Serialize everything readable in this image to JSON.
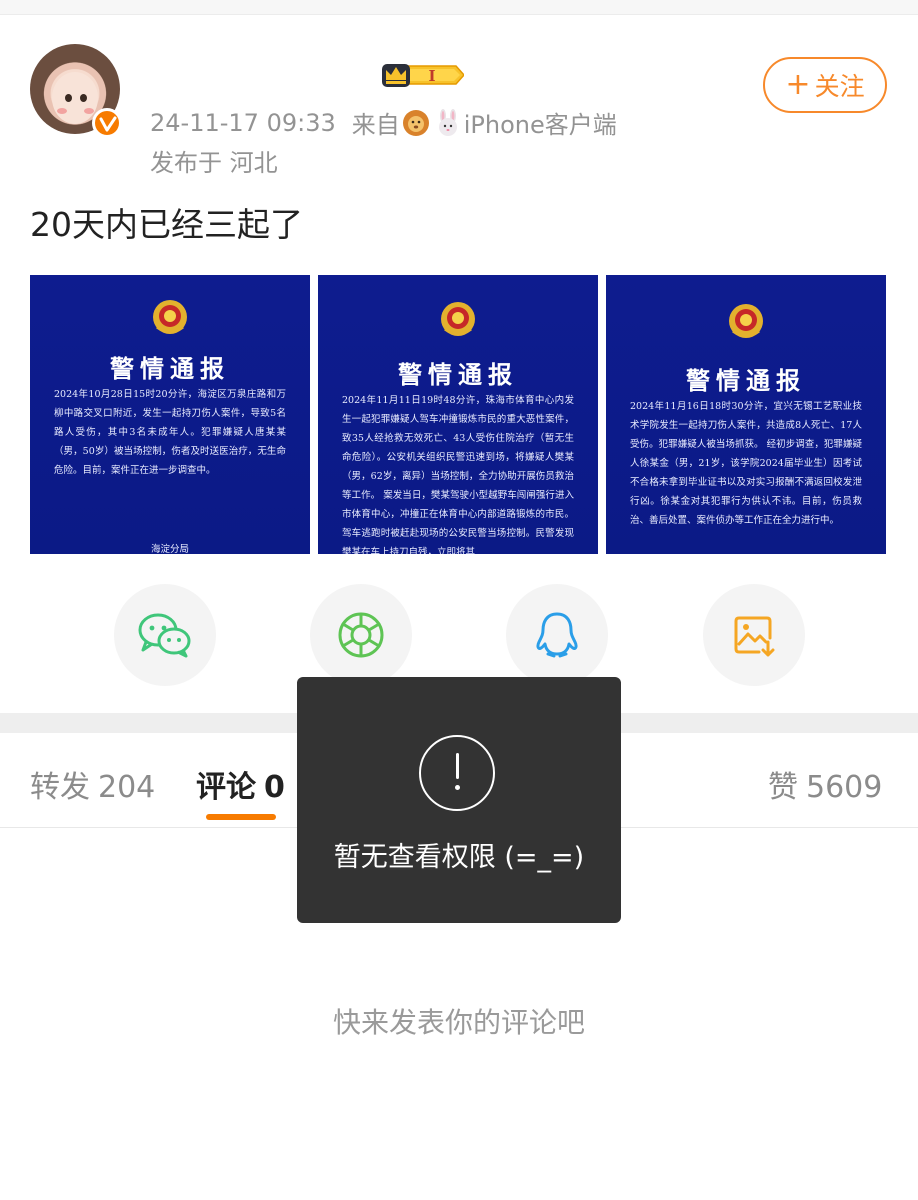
{
  "header": {
    "timestamp": "24-11-17 09:33",
    "source_prefix": "来自",
    "source_device": "iPhone客户端",
    "location": "发布于 河北",
    "follow_label": "关注",
    "badge_level": "I",
    "icons": {
      "avatar": "avatar",
      "verified": "verified-icon",
      "crown": "crown-icon",
      "lion": "lion-emoji-icon",
      "rabbit": "rabbit-emoji-icon"
    }
  },
  "post": {
    "text": "20天内已经三起了"
  },
  "images": [
    {
      "title": "警情通报",
      "body": "2024年10月28日15时20分许，海淀区万泉庄路和万柳中路交叉口附近，发生一起持刀伤人案件，导致5名路人受伤，其中3名未成年人。犯罪嫌疑人唐某某（男，50岁）被当场控制，伤者及时送医治疗，无生命危险。目前，案件正在进一步调查中。",
      "sign": "海淀分局"
    },
    {
      "title": "警情通报",
      "body": "2024年11月11日19时48分许，珠海市体育中心内发生一起犯罪嫌疑人驾车冲撞锻炼市民的重大恶性案件，致35人经抢救无效死亡、43人受伤住院治疗（暂无生命危险）。公安机关组织民警迅速到场，将嫌疑人樊某（男，62岁，离异）当场控制，全力协助开展伤员救治等工作。 案发当日，樊某驾驶小型越野车闯闸强行进入市体育中心，冲撞正在体育中心内部道路锻炼的市民。驾车逃跑时被赶赴现场的公安民警当场控制。民警发现樊某在车上持刀自残，立即将其",
      "sign": ""
    },
    {
      "title": "警情通报",
      "body": "2024年11月16日18时30分许，宜兴无锡工艺职业技术学院发生一起持刀伤人案件，共造成8人死亡、17人受伤。犯罪嫌疑人被当场抓获。 经初步调查，犯罪嫌疑人徐某金（男，21岁，该学院2024届毕业生）因考试不合格未拿到毕业证书以及对实习报酬不满返回校发泄行凶。徐某金对其犯罪行为供认不讳。目前，伤员救治、善后处置、案件侦办等工作正在全力进行中。",
      "sign": ""
    }
  ],
  "share": {
    "icons": [
      "wechat-icon",
      "moments-icon",
      "qq-icon",
      "save-image-icon"
    ]
  },
  "tabs": {
    "repost_label": "转发",
    "repost_count": "204",
    "comment_label": "评论",
    "comment_count": "0",
    "like_label": "赞",
    "like_count": "5609"
  },
  "comments": {
    "empty_hint": "快来发表你的评论吧"
  },
  "toast": {
    "message": "暂无查看权限 (=_=)"
  },
  "colors": {
    "accent": "#f77b00",
    "follow": "#f7892b",
    "poster_bg": "#0e1c8f",
    "wechat": "#3fc67a",
    "moments": "#5ec454",
    "qq": "#2a9ee8",
    "save": "#f5a623"
  }
}
